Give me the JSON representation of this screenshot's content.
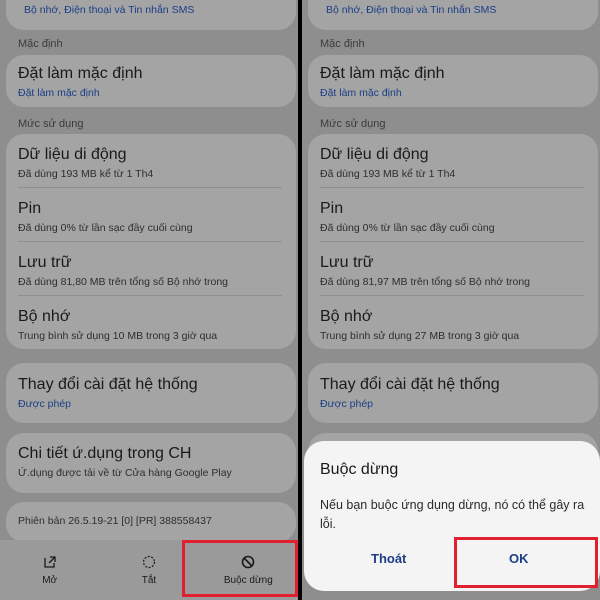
{
  "left": {
    "top_link": "Bộ nhớ, Điện thoại và Tin nhắn SMS",
    "default_section": "Mặc định",
    "set_default": {
      "title": "Đặt làm mặc định",
      "sub": "Đặt làm mặc định"
    },
    "usage_section": "Mức sử dụng",
    "mobile_data": {
      "title": "Dữ liệu di động",
      "sub": "Đã dùng 193 MB kể từ 1 Th4"
    },
    "battery": {
      "title": "Pin",
      "sub": "Đã dùng 0% từ lần sạc đầy cuối cùng"
    },
    "storage": {
      "title": "Lưu trữ",
      "sub": "Đã dùng 81,80 MB trên tổng số Bộ nhớ trong"
    },
    "memory": {
      "title": "Bộ nhớ",
      "sub": "Trung bình sử dụng 10 MB trong 3 giờ qua"
    },
    "system_settings": {
      "title": "Thay đổi cài đặt hệ thống",
      "sub": "Được phép"
    },
    "store_details": {
      "title": "Chi tiết ứ.dụng trong CH",
      "sub": "Ứ.dụng được tải về từ Cửa hàng Google Play"
    },
    "version": "Phiên bản 26.5.19-21 [0] [PR] 388558437",
    "bottom": {
      "open": "Mở",
      "off": "Tắt",
      "force_stop": "Buộc dừng"
    }
  },
  "right": {
    "top_link": "Bộ nhớ, Điện thoại và Tin nhắn SMS",
    "default_section": "Mặc định",
    "set_default": {
      "title": "Đặt làm mặc định",
      "sub": "Đặt làm mặc định"
    },
    "usage_section": "Mức sử dụng",
    "mobile_data": {
      "title": "Dữ liệu di động",
      "sub": "Đã dùng 193 MB kể từ 1 Th4"
    },
    "battery": {
      "title": "Pin",
      "sub": "Đã dùng 0% từ lần sạc đầy cuối cùng"
    },
    "storage": {
      "title": "Lưu trữ",
      "sub": "Đã dùng 81,97 MB trên tổng số Bộ nhớ trong"
    },
    "memory": {
      "title": "Bộ nhớ",
      "sub": "Trung bình sử dụng 27 MB trong 3 giờ qua"
    },
    "system_settings": {
      "title": "Thay đổi cài đặt hệ thống",
      "sub": "Được phép"
    },
    "dialog": {
      "title": "Buộc dừng",
      "message": "Nếu bạn buộc ứng dụng dừng, nó có thể gây ra lỗi.",
      "cancel": "Thoát",
      "ok": "OK"
    }
  },
  "colors": {
    "highlight": "#e0202e",
    "link": "#1b3e86",
    "dim_background": "#8e8e8e"
  }
}
